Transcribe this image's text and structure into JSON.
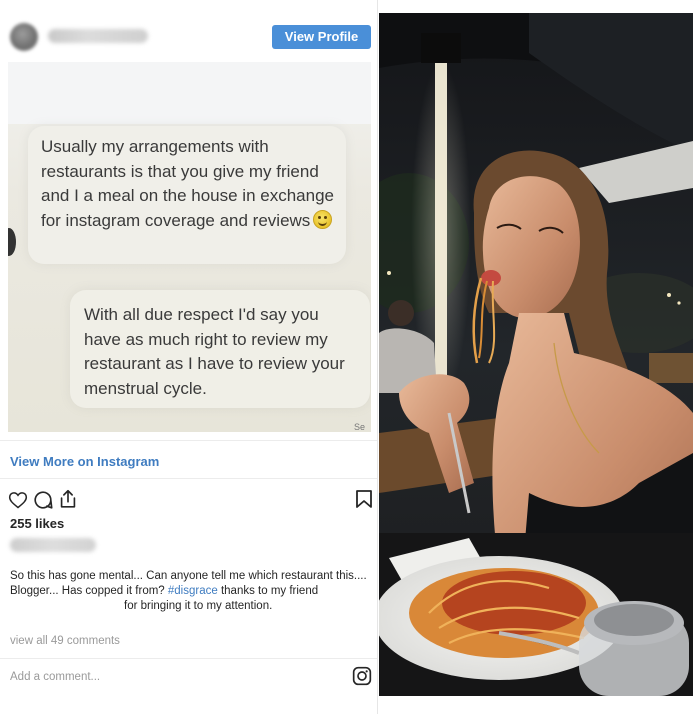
{
  "embed": {
    "view_profile_label": "View Profile",
    "post_messages": {
      "message_1": "Usually my arrangements with restaurants is that you give my friend and I a meal on the house in exchange for instagram coverage and reviews",
      "message_2": "With all due respect I'd say you have as much right to review my restaurant as I have to review your menstrual cycle.",
      "corner_text": "Se"
    },
    "view_more_label": "View More on Instagram",
    "actions": [
      "heart-icon",
      "comment-icon",
      "share-icon",
      "bookmark-icon"
    ],
    "likes": "255 likes",
    "caption_part1": "So this has gone mental... Can anyone tell me which restaurant this.... Blogger... Has copped it from? ",
    "caption_hashtag": "#disgrace",
    "caption_part2": " thanks to my friend",
    "caption_part3": "for bringing it to my attention.",
    "view_comments": "view all 49 comments",
    "add_comment_placeholder": "Add a comment...",
    "accent_color": "#4a8fd8",
    "link_color": "#3f7cc0"
  }
}
